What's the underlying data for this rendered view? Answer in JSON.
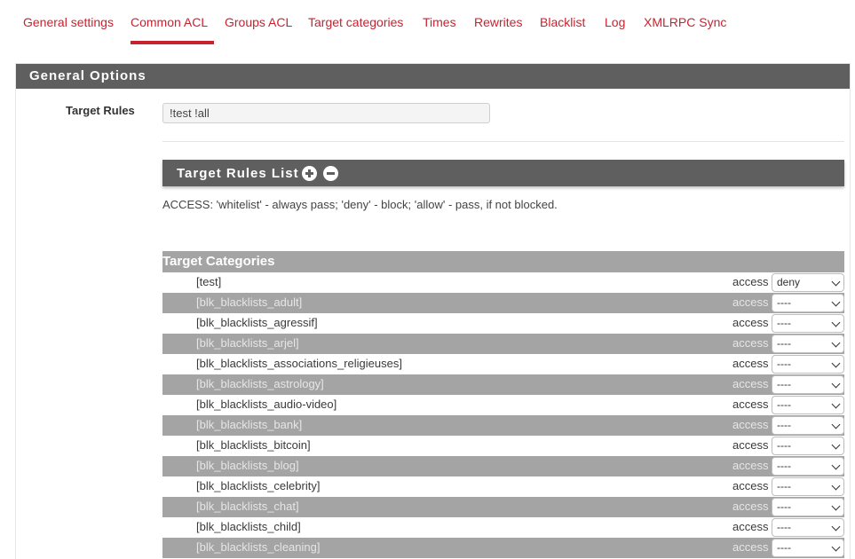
{
  "tabs": [
    {
      "label": "General settings"
    },
    {
      "label": "Common ACL"
    },
    {
      "label": "Groups ACL"
    },
    {
      "label": "Target categories"
    },
    {
      "label": "Times"
    },
    {
      "label": "Rewrites"
    },
    {
      "label": "Blacklist"
    },
    {
      "label": "Log"
    },
    {
      "label": "XMLRPC Sync"
    }
  ],
  "active_tab": "Common ACL",
  "panel": {
    "title": "General Options"
  },
  "target_rules": {
    "label": "Target Rules",
    "value": "!test !all"
  },
  "rules_list": {
    "title": "Target Rules List"
  },
  "access_hint": "ACCESS: 'whitelist' - always pass; 'deny' - block; 'allow' - pass, if not blocked.",
  "categories": {
    "title": "Target Categories",
    "access_label": "access",
    "rows": [
      {
        "name": "[test]",
        "value": "deny"
      },
      {
        "name": "[blk_blacklists_adult]",
        "value": "----"
      },
      {
        "name": "[blk_blacklists_agressif]",
        "value": "----"
      },
      {
        "name": "[blk_blacklists_arjel]",
        "value": "----"
      },
      {
        "name": "[blk_blacklists_associations_religieuses]",
        "value": "----"
      },
      {
        "name": "[blk_blacklists_astrology]",
        "value": "----"
      },
      {
        "name": "[blk_blacklists_audio-video]",
        "value": "----"
      },
      {
        "name": "[blk_blacklists_bank]",
        "value": "----"
      },
      {
        "name": "[blk_blacklists_bitcoin]",
        "value": "----"
      },
      {
        "name": "[blk_blacklists_blog]",
        "value": "----"
      },
      {
        "name": "[blk_blacklists_celebrity]",
        "value": "----"
      },
      {
        "name": "[blk_blacklists_chat]",
        "value": "----"
      },
      {
        "name": "[blk_blacklists_child]",
        "value": "----"
      },
      {
        "name": "[blk_blacklists_cleaning]",
        "value": "----"
      }
    ]
  },
  "colors": {
    "accent": "#c9222f",
    "header_bg": "#5f5f5f",
    "alt_row_bg": "#a4a4a4"
  }
}
